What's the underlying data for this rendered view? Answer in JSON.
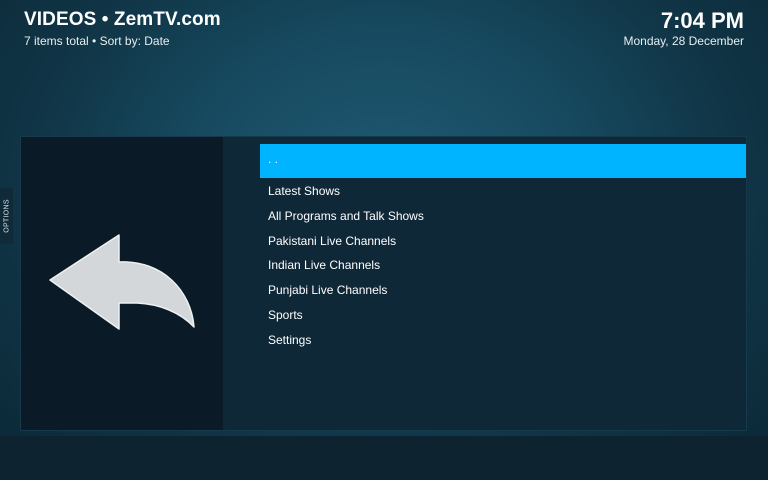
{
  "header": {
    "title": "VIDEOS • ZemTV.com",
    "subtitle": "7 items total • Sort by: Date"
  },
  "clock": {
    "time": "7:04 PM",
    "date": "Monday, 28 December"
  },
  "sidebar": {
    "options_label": "OPTIONS"
  },
  "preview": {
    "icon": "back-arrow-icon"
  },
  "list": {
    "items": [
      {
        "label": ". .",
        "selected": true
      },
      {
        "label": "Latest Shows"
      },
      {
        "label": "All Programs and Talk Shows"
      },
      {
        "label": "Pakistani Live Channels"
      },
      {
        "label": "Indian Live Channels"
      },
      {
        "label": "Punjabi Live Channels"
      },
      {
        "label": "Sports"
      },
      {
        "label": "Settings"
      }
    ]
  },
  "colors": {
    "accent": "#00b4ff",
    "background": "#174a60",
    "panel": "#0f2838"
  }
}
